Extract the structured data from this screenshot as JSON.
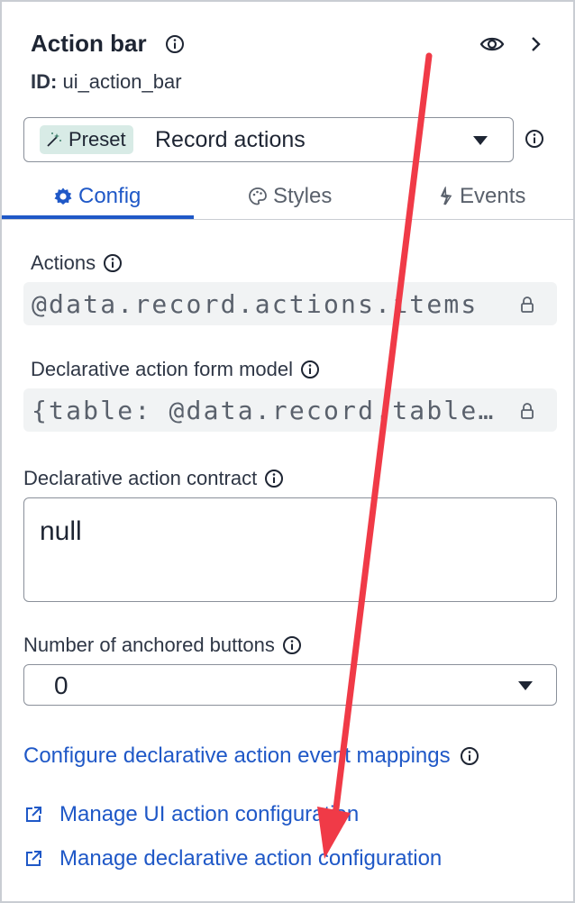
{
  "header": {
    "title": "Action bar",
    "id_label": "ID:",
    "id_value": "ui_action_bar"
  },
  "preset": {
    "badge": "Preset",
    "value": "Record actions"
  },
  "tabs": [
    {
      "label": "Config",
      "active": true
    },
    {
      "label": "Styles",
      "active": false
    },
    {
      "label": "Events",
      "active": false
    }
  ],
  "fields": {
    "actions": {
      "label": "Actions",
      "value": "@data.record.actions.items"
    },
    "form_model": {
      "label": "Declarative action form model",
      "value": "{table: @data.record.table…"
    },
    "contract": {
      "label": "Declarative action contract",
      "value": "null"
    },
    "anchored": {
      "label": "Number of anchored buttons",
      "value": "0"
    }
  },
  "links": {
    "event_mappings": "Configure declarative action event mappings",
    "manage_ui": "Manage UI action configuration",
    "manage_declarative": "Manage declarative action configuration"
  },
  "colors": {
    "accent": "#1f58c7",
    "annotation_arrow": "#f03a47",
    "badge_bg": "#d8ebe6"
  },
  "icons": [
    "info-icon",
    "eye-icon",
    "chevron-right-icon",
    "magic-wand-icon",
    "gear-icon",
    "palette-icon",
    "bolt-icon",
    "lock-icon",
    "external-link-icon",
    "dropdown-caret-icon"
  ]
}
